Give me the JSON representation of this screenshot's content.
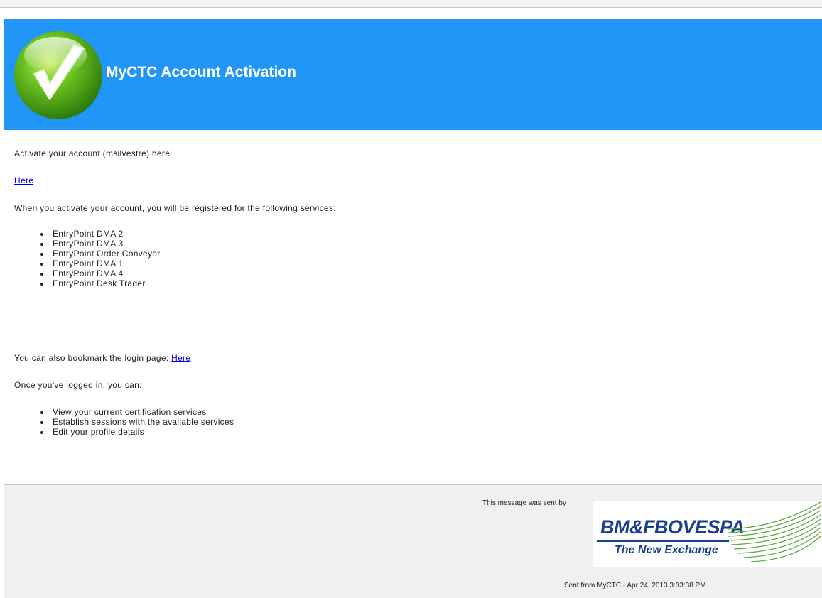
{
  "header": {
    "title": "MyCTC Account Activation",
    "icon": "checkmark-icon",
    "background_color": "#2196f7"
  },
  "body": {
    "activate_text": "Activate your account (msilvestre) here:",
    "activate_link": "Here",
    "services_intro": "When you activate your account, you will be registered for the following services:",
    "services": [
      "EntryPoint DMA 2",
      "EntryPoint DMA 3",
      "EntryPoint Order Conveyor",
      "EntryPoint DMA 1",
      "EntryPoint DMA 4",
      "EntryPoint Desk Trader"
    ],
    "bookmark_text": "You can also bookmark the login page:",
    "bookmark_link": "Here",
    "logged_in_intro": "Once you've logged in, you can:",
    "capabilities": [
      "View your current certification services",
      "Establish sessions with the available services",
      "Edit your profile details"
    ],
    "link_color": "#0000ee"
  },
  "footer": {
    "sent_by": "This message was sent by",
    "logo_name": "BM&FBOVESPA",
    "logo_tagline": "The New Exchange",
    "logo_color": "#1a3f8f",
    "sent_from": "Sent from MyCTC - Apr 24, 2013 3:03:38 PM"
  }
}
